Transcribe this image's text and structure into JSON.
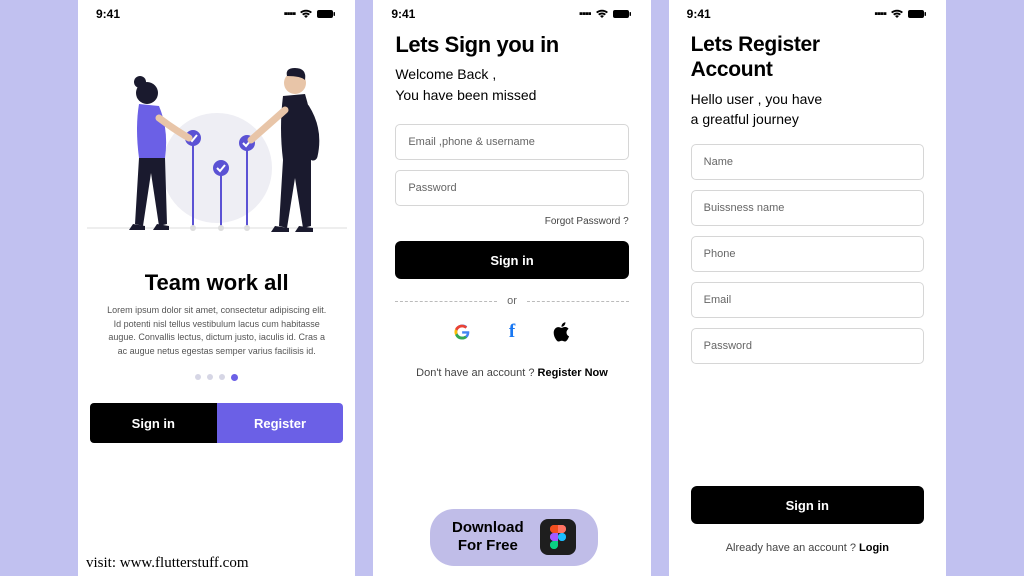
{
  "status": {
    "time": "9:41"
  },
  "onboard": {
    "title": "Team work all",
    "desc": "Lorem ipsum dolor sit amet, consectetur adipiscing elit. Id potenti nisl tellus vestibulum lacus cum habitasse augue. Convallis lectus, dictum justo, iaculis id. Cras a ac augue netus egestas semper varius facilisis id.",
    "signin": "Sign in",
    "register": "Register"
  },
  "signin": {
    "title": "Lets Sign you in",
    "sub1": "Welcome Back ,",
    "sub2": "You have been missed",
    "input_user": "Email ,phone & username",
    "input_pass": "Password",
    "forgot": "Forgot Password ?",
    "btn": "Sign in",
    "or": "or",
    "footer_q": "Don't have an account ? ",
    "footer_link": "Register Now"
  },
  "register": {
    "title1": "Lets Register",
    "title2": "Account",
    "sub1": "Hello user , you have",
    "sub2": "a greatful journey",
    "input_name": "Name",
    "input_biz": "Buissness name",
    "input_phone": "Phone",
    "input_email": "Email",
    "input_pass": "Password",
    "btn": "Sign in",
    "footer_q": "Already  have an account ? ",
    "footer_link": "Login"
  },
  "download": {
    "line1": "Download",
    "line2": "For Free"
  },
  "visit": "visit: www.flutterstuff.com"
}
